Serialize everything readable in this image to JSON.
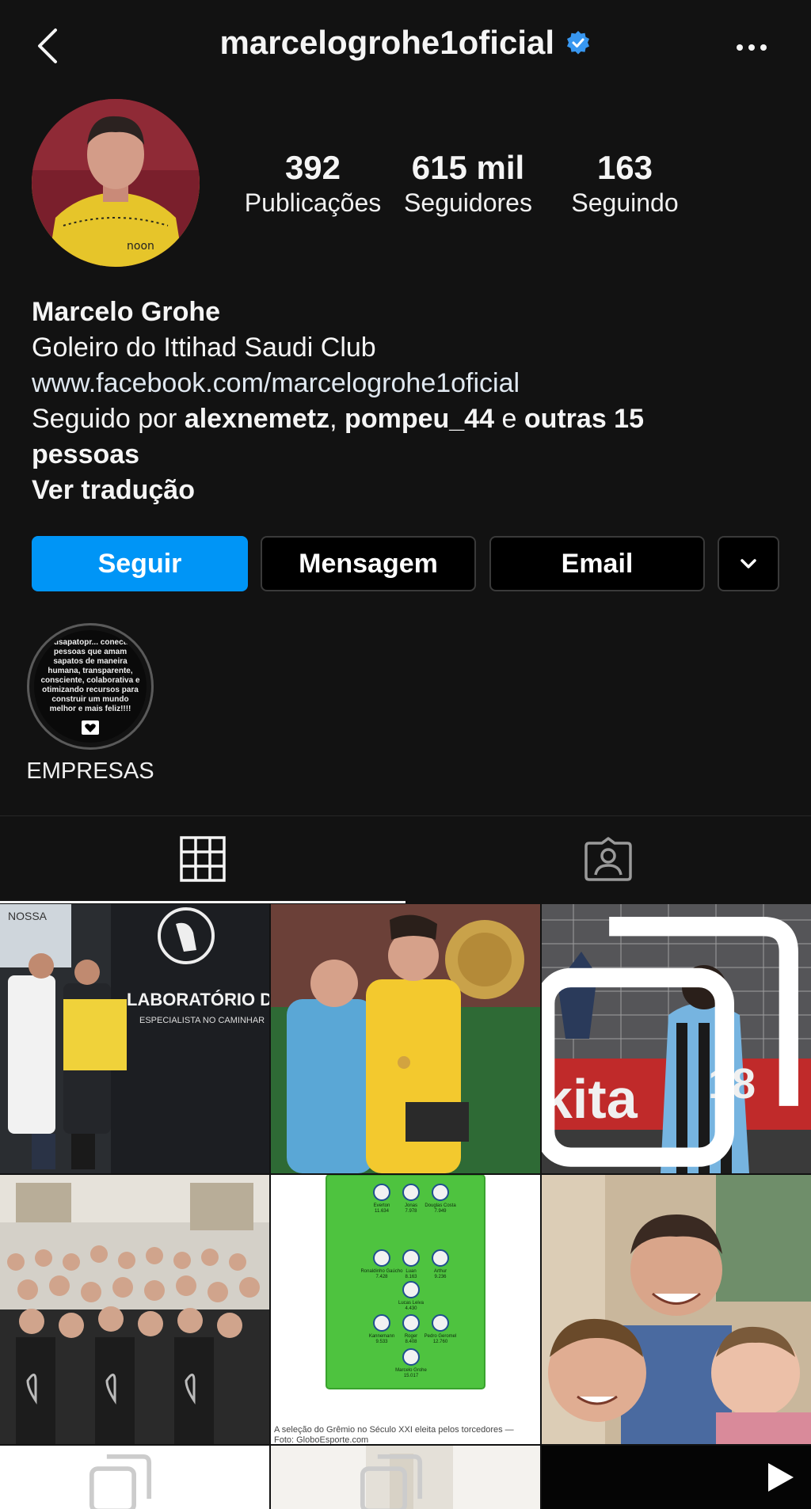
{
  "header": {
    "username": "marcelogrohe1oficial",
    "back_icon": "chevron-left-icon",
    "verified_icon": "verified-badge-icon",
    "more_icon": "ellipsis-icon"
  },
  "stats": {
    "posts": {
      "value": "392",
      "label": "Publicações"
    },
    "followers": {
      "value": "615 mil",
      "label": "Seguidores"
    },
    "following": {
      "value": "163",
      "label": "Seguindo"
    }
  },
  "bio": {
    "name": "Marcelo Grohe",
    "description": "Goleiro do Ittihad Saudi Club",
    "website": "www.facebook.com/marcelogrohe1oficial",
    "followed_by_prefix": "Seguido por ",
    "followed_user_1": "alexnemetz",
    "comma": ", ",
    "followed_user_2": "pompeu_44",
    "and": " e ",
    "others": "outras 15 pessoas",
    "translate": "Ver tradução"
  },
  "actions": {
    "follow": "Seguir",
    "message": "Mensagem",
    "email": "Email",
    "dropdown_icon": "chevron-down-icon"
  },
  "highlight": {
    "cover_text": "...usapatopr... conectar pessoas que amam sapatos de maneira humana, transparente, consciente, colaborativa e otimizando recursos para construir um mundo melhor e mais feliz!!!!",
    "label": "EMPRESAS"
  },
  "tabs": {
    "grid_icon": "grid-icon",
    "tagged_icon": "tagged-person-icon"
  },
  "posts": [
    {
      "caption": "LABORATÓRIO DO PÉ",
      "subcaption": "ESPECIALISTA NO CAMINHAR",
      "corner_text": "NOSSA"
    },
    {
      "caption": ""
    },
    {
      "caption": "kita",
      "jersey": "18"
    },
    {
      "caption": ""
    },
    {
      "caption": "A seleção do Grêmio no Século XXI eleita pelos torcedores — Foto: GloboEsporte.com",
      "players": [
        {
          "name": "Everton",
          "score": "11.634"
        },
        {
          "name": "Jonas",
          "score": "7.978"
        },
        {
          "name": "Douglas Costa",
          "score": "7.949"
        },
        {
          "name": "Ronaldinho Gaúcho",
          "score": "7.428"
        },
        {
          "name": "Luan",
          "score": "8.163"
        },
        {
          "name": "Arthur",
          "score": "9.236"
        },
        {
          "name": "Lucas Leiva",
          "score": "4.430"
        },
        {
          "name": "Kannemann",
          "score": "9.533"
        },
        {
          "name": "Roger",
          "score": "8.408"
        },
        {
          "name": "Pedro Geromel",
          "score": "12.760"
        },
        {
          "name": "Marcelo Grohe",
          "score": "15.017"
        }
      ]
    },
    {
      "caption": ""
    }
  ]
}
